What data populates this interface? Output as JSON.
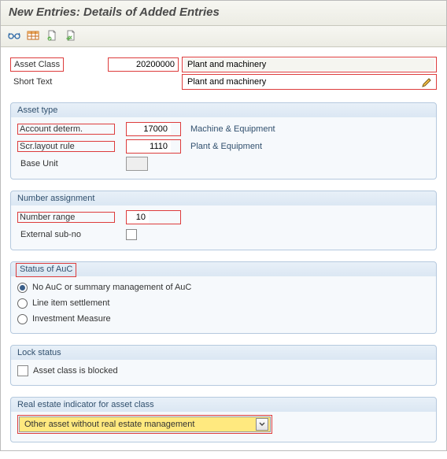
{
  "window": {
    "title": "New Entries: Details of Added Entries"
  },
  "header": {
    "asset_class_label": "Asset Class",
    "asset_class_value": "20200000",
    "asset_class_desc": "Plant and machinery",
    "short_text_label": "Short Text",
    "short_text_value": "Plant and machinery"
  },
  "groups": {
    "asset_type": {
      "title": "Asset type",
      "account_determ_label": "Account determ.",
      "account_determ_value": "17000",
      "account_determ_desc": "Machine & Equipment",
      "scr_layout_label": "Scr.layout rule",
      "scr_layout_value": "1110",
      "scr_layout_desc": "Plant & Equipment",
      "base_unit_label": "Base Unit",
      "base_unit_value": ""
    },
    "number_assignment": {
      "title": "Number assignment",
      "number_range_label": "Number range",
      "number_range_value": "10",
      "external_subno_label": "External sub-no",
      "external_subno_checked": false
    },
    "status_auc": {
      "title": "Status of AuC",
      "opt1": "No AuC or summary management of AuC",
      "opt2": "Line item settlement",
      "opt3": "Investment Measure",
      "selected": 0
    },
    "lock_status": {
      "title": "Lock status",
      "asset_blocked_label": "Asset class is blocked",
      "asset_blocked_checked": false
    },
    "real_estate": {
      "title": "Real estate indicator for asset class",
      "selected": "Other asset without real estate management"
    }
  },
  "icons": {
    "glasses": "glasses-icon",
    "table": "table-icon",
    "page_green": "page-green-icon",
    "page_plain": "page-plain-icon",
    "pencil": "pencil-icon",
    "chevron_down": "chevron-down-icon"
  }
}
